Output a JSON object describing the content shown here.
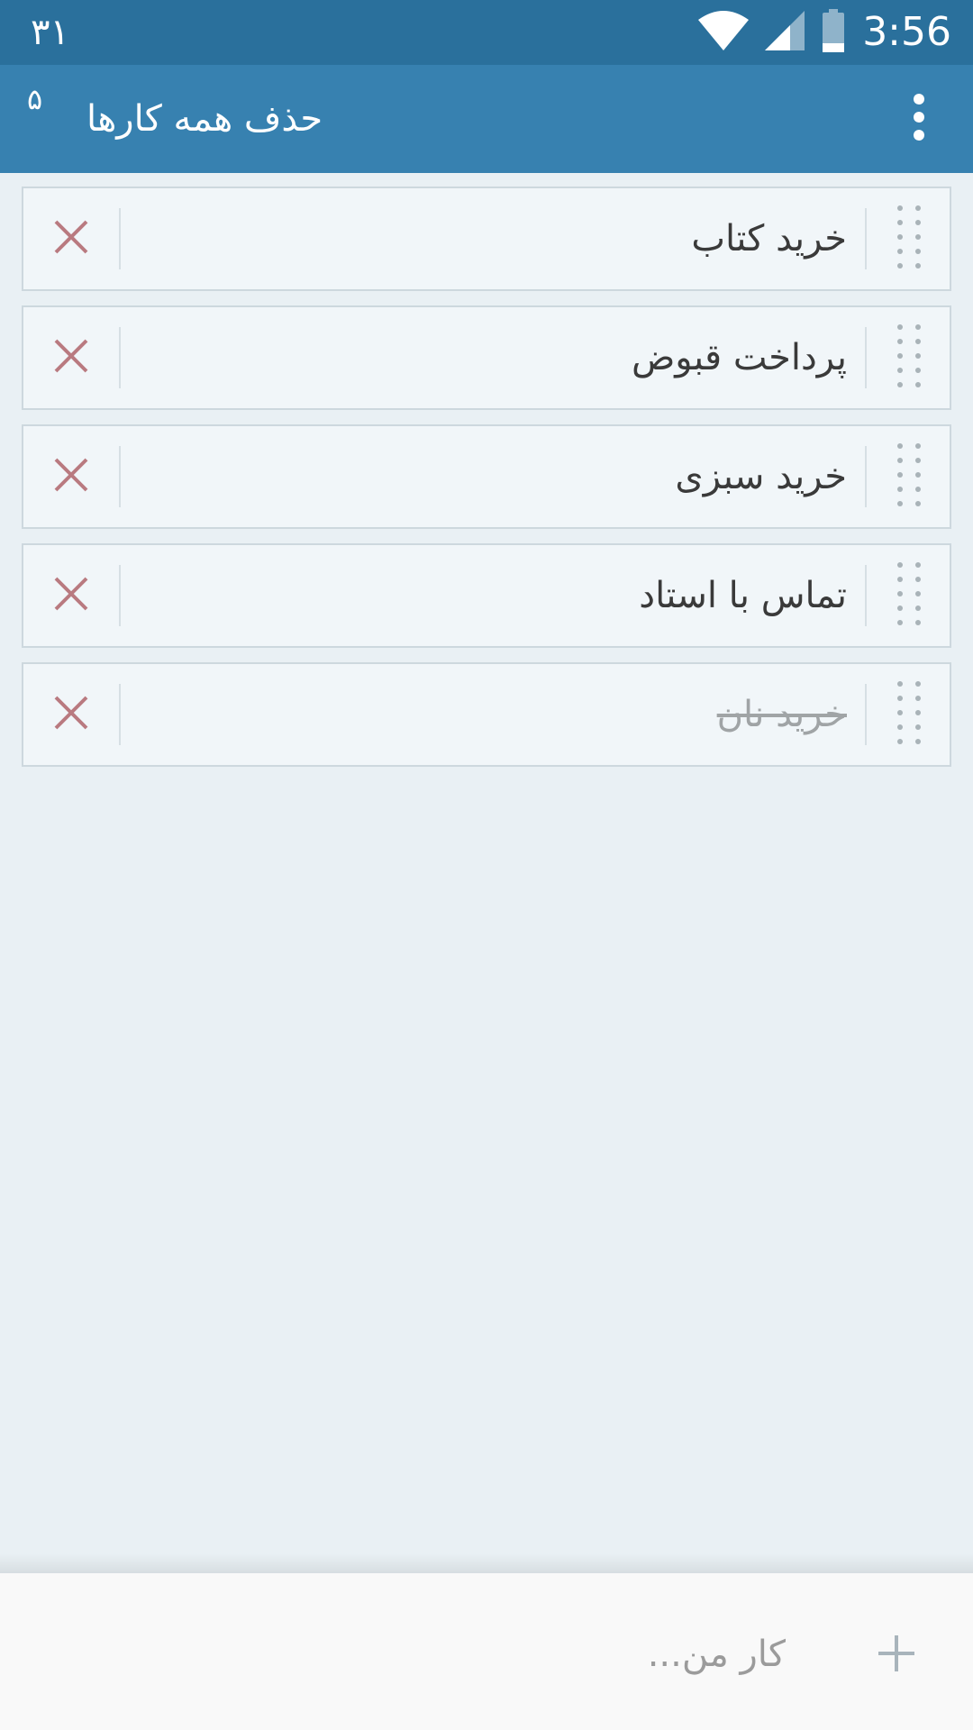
{
  "status_bar": {
    "left_text": "۳۱",
    "time": "3:56"
  },
  "app_bar": {
    "count": "۵",
    "title": "حذف همه کارها"
  },
  "tasks": [
    {
      "label": "خرید کتاب",
      "done": false
    },
    {
      "label": "پرداخت قبوض",
      "done": false
    },
    {
      "label": "خرید سبزی",
      "done": false
    },
    {
      "label": "تماس با استاد",
      "done": false
    },
    {
      "label": "خرید نان",
      "done": true
    }
  ],
  "input": {
    "placeholder": "کار من..."
  },
  "colors": {
    "status_bar": "#2a709c",
    "app_bar": "#3781b0",
    "delete_icon": "#b97a80",
    "handle_dots": "#a9b3b8"
  },
  "icons": {
    "delete": "close-icon",
    "handle": "drag-handle-icon",
    "menu": "more-vert-icon",
    "add": "plus-icon"
  }
}
